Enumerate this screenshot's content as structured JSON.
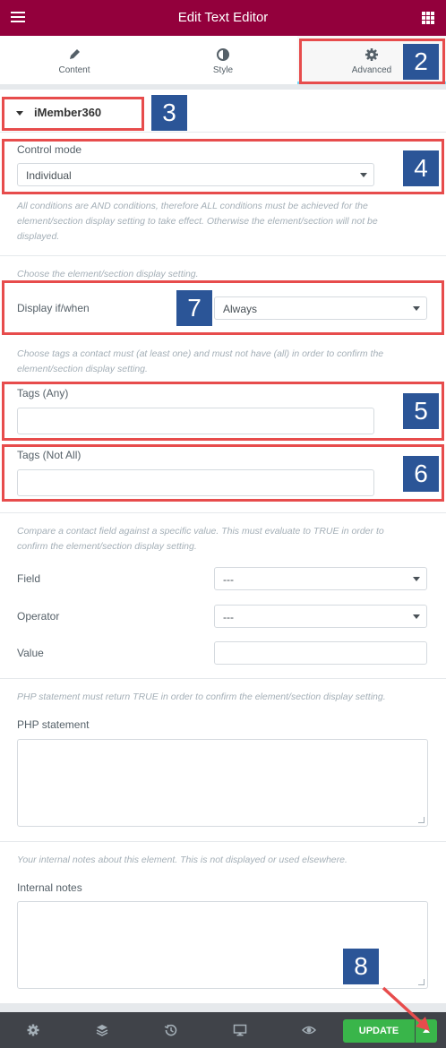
{
  "header": {
    "title": "Edit Text Editor"
  },
  "tabs": [
    {
      "label": "Content",
      "icon": "pencil-icon"
    },
    {
      "label": "Style",
      "icon": "half-circle-icon"
    },
    {
      "label": "Advanced",
      "icon": "gear-icon"
    }
  ],
  "section": {
    "title": "iMember360"
  },
  "control_mode": {
    "label": "Control mode",
    "value": "Individual"
  },
  "desc_conditions": "All conditions are AND conditions, therefore ALL conditions must be achieved for the element/section display setting to take effect. Otherwise the element/section will not be displayed.",
  "desc_display": "Choose the element/section display setting.",
  "display_if": {
    "label": "Display if/when",
    "value": "Always"
  },
  "desc_tags": "Choose tags a contact must (at least one) and must not have (all) in order to confirm the element/section display setting.",
  "tags_any": {
    "label": "Tags (Any)",
    "value": ""
  },
  "tags_not_all": {
    "label": "Tags (Not All)",
    "value": ""
  },
  "desc_field": "Compare a contact field against a specific value. This must evaluate to TRUE in order to confirm the element/section display setting.",
  "field": {
    "label": "Field",
    "value": "---"
  },
  "operator": {
    "label": "Operator",
    "value": "---"
  },
  "value_field": {
    "label": "Value",
    "value": ""
  },
  "desc_php": "PHP statement must return TRUE in order to confirm the element/section display setting.",
  "php": {
    "label": "PHP statement",
    "value": ""
  },
  "desc_notes": "Your internal notes about this element. This is not displayed or used elsewhere.",
  "notes": {
    "label": "Internal notes",
    "value": ""
  },
  "footer": {
    "update_label": "UPDATE"
  },
  "annotations": [
    "2",
    "3",
    "4",
    "5",
    "6",
    "7",
    "8"
  ],
  "colors": {
    "header": "#93003c",
    "update": "#39b54a",
    "annotation_box": "#e74c4c",
    "annotation_badge": "#2b5597"
  }
}
